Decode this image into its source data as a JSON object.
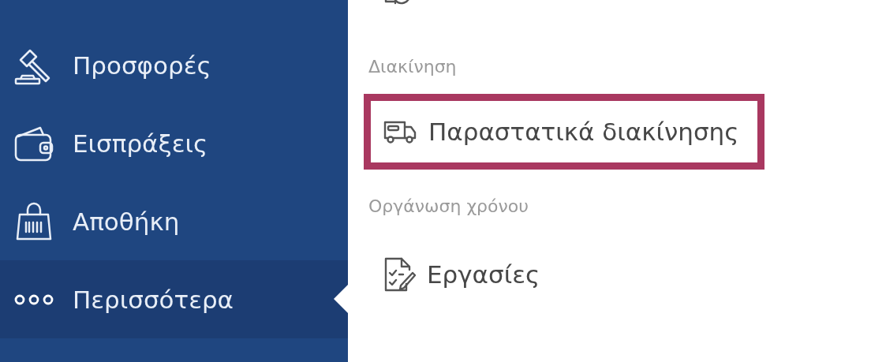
{
  "sidebar": {
    "items": [
      {
        "kind": "gavel",
        "label": "Προσφορές",
        "selected": false
      },
      {
        "kind": "wallet",
        "label": "Εισπράξεις",
        "selected": false
      },
      {
        "kind": "bag",
        "label": "Αποθήκη",
        "selected": false
      },
      {
        "kind": "dots",
        "label": "Περισσότερα",
        "selected": true
      }
    ]
  },
  "menu": {
    "groups": [
      {
        "items": [
          {
            "kind": "repeat",
            "highlighted": false
          }
        ]
      },
      {
        "heading": "Διακίνηση",
        "items": [
          {
            "kind": "truck",
            "label": "Παραστατικά διακίνησης",
            "highlighted": true
          }
        ]
      },
      {
        "heading": "Οργάνωση χρόνου",
        "items": [
          {
            "kind": "tasks",
            "label": "Εργασίες",
            "highlighted": false
          }
        ]
      }
    ]
  }
}
